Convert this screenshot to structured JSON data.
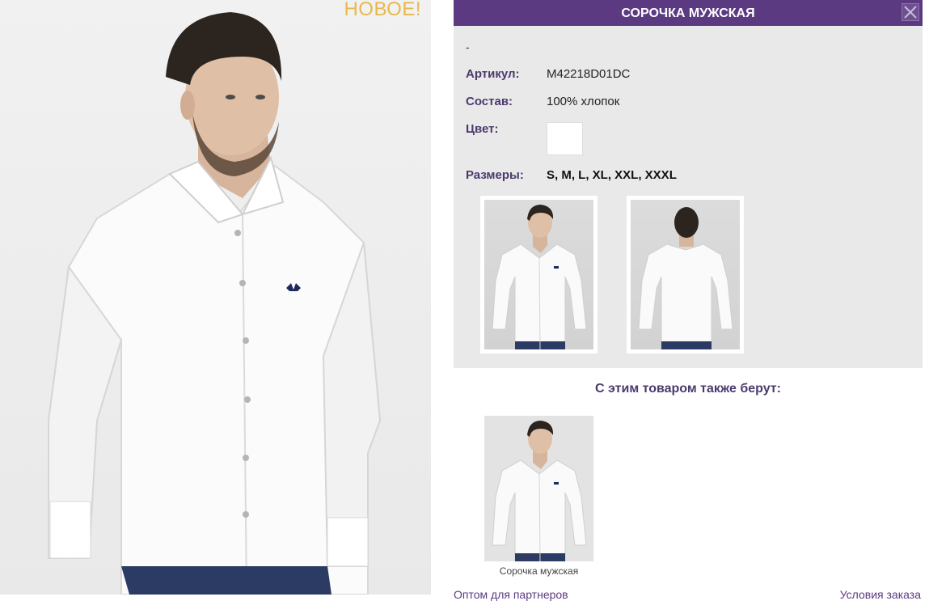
{
  "hero": {
    "badge": "НОВОЕ!"
  },
  "product": {
    "title": "СОРОЧКА МУЖСКАЯ",
    "dash": "-",
    "article_label": "Артикул:",
    "article_value": "M42218D01DC",
    "composition_label": "Состав:",
    "composition_value": "100% хлопок",
    "color_label": "Цвет:",
    "color_swatch": "#ffffff",
    "sizes_label": "Размеры:",
    "sizes_value": "S, M, L, XL, XXL, XXXL"
  },
  "related": {
    "title": "С этим товаром также берут:",
    "items": [
      {
        "caption": "Сорочка мужская"
      }
    ]
  },
  "footer": {
    "left_link": "Оптом для партнеров",
    "right_link": "Условия заказа"
  },
  "colors": {
    "accent": "#5b3a82",
    "label": "#4b3a6e",
    "new_badge": "#e8b84a"
  }
}
